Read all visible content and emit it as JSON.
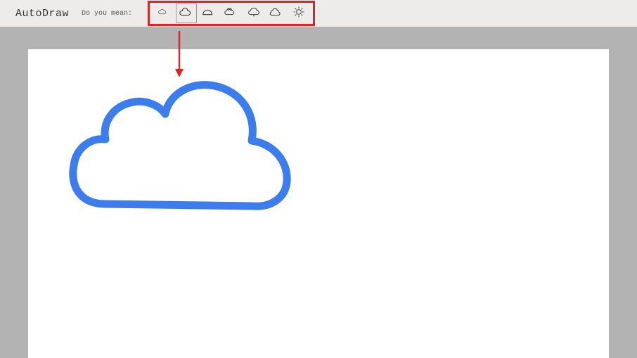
{
  "header": {
    "app_title": "AutoDraw",
    "prompt_label": "Do you mean:"
  },
  "suggestions": [
    {
      "icon": "cloud-small-icon",
      "selected": false
    },
    {
      "icon": "cloud-outline-icon",
      "selected": true
    },
    {
      "icon": "cloud-half-icon",
      "selected": false
    },
    {
      "icon": "cloud-puffy-icon",
      "selected": false
    },
    {
      "icon": "cloud-tree-icon",
      "selected": false
    },
    {
      "icon": "cloud-bush-icon",
      "selected": false
    },
    {
      "icon": "sun-burst-icon",
      "selected": false
    }
  ],
  "canvas": {
    "drawing": "cloud",
    "stroke_color": "#3b7ded"
  },
  "annotation": {
    "arrow_color": "#d62828",
    "highlight_color": "#d62828"
  }
}
